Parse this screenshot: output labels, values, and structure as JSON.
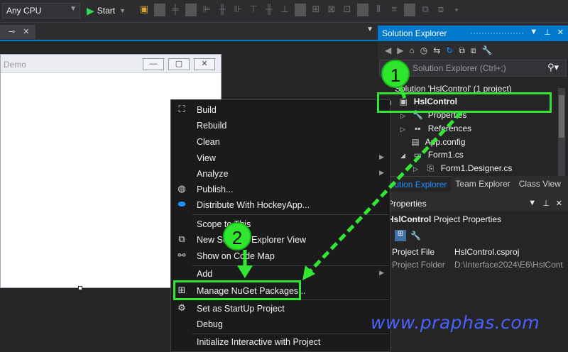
{
  "toolbar": {
    "platform_value": "Any CPU",
    "start_label": "Start",
    "icons": [
      "solution-config-icon",
      "align-left-icon",
      "align-center-icon",
      "align-right-icon",
      "align-top-icon",
      "align-middle-icon",
      "align-bottom-icon",
      "spacing-icon",
      "resize-icon",
      "order-icon"
    ]
  },
  "designer": {
    "form_title": "Demo",
    "min_glyph": "—",
    "max_glyph": "▢",
    "close_glyph": "✕"
  },
  "solution_explorer": {
    "title": "Solution Explorer",
    "search_placeholder": "Solution Explorer (Ctrl+;)",
    "tree": [
      {
        "label": "Solution 'HslControl' (1 project)",
        "icon": "solution-icon"
      },
      {
        "label": "HslControl",
        "icon": "csharp-project-icon",
        "bold": true
      },
      {
        "label": "Properties",
        "icon": "wrench-icon"
      },
      {
        "label": "References",
        "icon": "references-icon"
      },
      {
        "label": "App.config",
        "icon": "config-file-icon"
      },
      {
        "label": "Form1.cs",
        "icon": "form-icon"
      },
      {
        "label": "Form1.Designer.cs",
        "icon": "csharp-file-icon"
      }
    ],
    "tabs": [
      "Solution Explorer",
      "Team Explorer",
      "Class View"
    ]
  },
  "properties": {
    "title": "Properties",
    "object_name": "HslControl",
    "object_type": "Project Properties",
    "rows": [
      {
        "key": "Project File",
        "value": "HslControl.csproj"
      },
      {
        "key": "Project Folder",
        "value": "D:\\Interface2024\\E6\\HslCont"
      }
    ]
  },
  "context_menu": {
    "items": [
      {
        "label": "Build",
        "icon": "build-icon",
        "submenu": false
      },
      {
        "label": "Rebuild",
        "icon": "",
        "submenu": false
      },
      {
        "label": "Clean",
        "icon": "",
        "submenu": false
      },
      {
        "label": "View",
        "icon": "",
        "submenu": true
      },
      {
        "label": "Analyze",
        "icon": "",
        "submenu": true
      },
      {
        "label": "Publish...",
        "icon": "globe-icon",
        "submenu": false
      },
      {
        "label": "Distribute With HockeyApp...",
        "icon": "hockeyapp-icon",
        "submenu": false
      },
      {
        "label": "Scope to This",
        "icon": "",
        "submenu": false
      },
      {
        "label": "New Solution Explorer View",
        "icon": "new-view-icon",
        "submenu": false
      },
      {
        "label": "Show on Code Map",
        "icon": "code-map-icon",
        "submenu": false
      },
      {
        "label": "Add",
        "icon": "",
        "submenu": true
      },
      {
        "label": "Manage NuGet Packages...",
        "icon": "nuget-icon",
        "submenu": false
      },
      {
        "label": "Set as StartUp Project",
        "icon": "gear-icon",
        "submenu": false
      },
      {
        "label": "Debug",
        "icon": "",
        "submenu": true
      },
      {
        "label": "Initialize Interactive with Project",
        "icon": "",
        "submenu": false
      }
    ]
  },
  "annotations": {
    "step1": "1",
    "step2": "2"
  },
  "watermark": "www.praphas.com",
  "colors": {
    "accent": "#007acc",
    "highlight": "#33e633",
    "watermark": "#4a60ff"
  }
}
